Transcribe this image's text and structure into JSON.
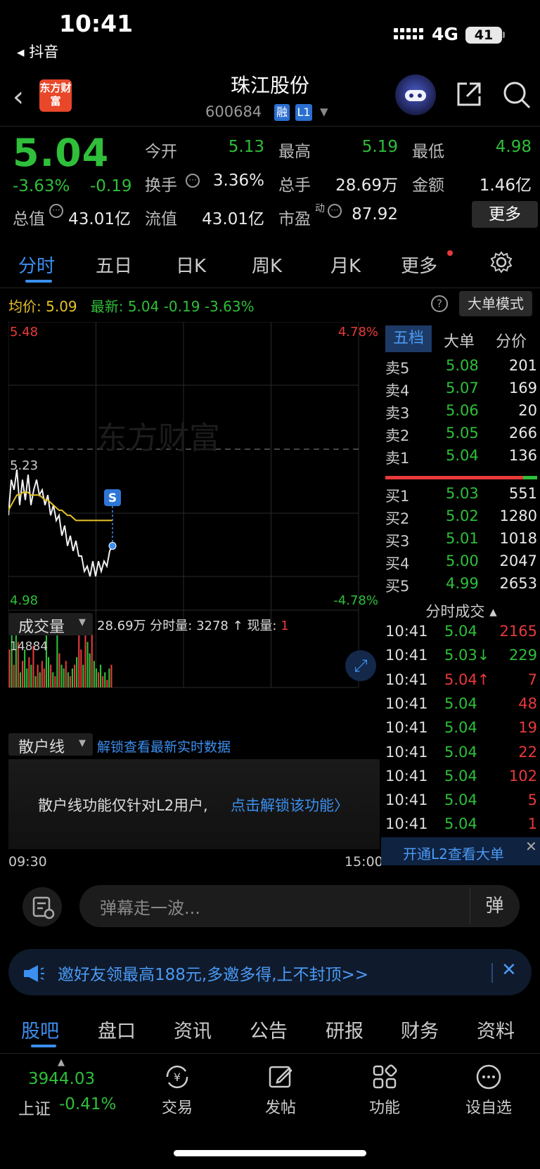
{
  "status_bar": {
    "time": "10:41",
    "back_app": "◂ 抖音",
    "network": "4G",
    "battery": "41"
  },
  "header": {
    "logo_text": "东方财富",
    "stock_name": "珠江股份",
    "stock_code": "600684",
    "tag_rong": "融",
    "tag_l1": "L1",
    "icons": [
      "back-icon",
      "robot-avatar-icon",
      "share-icon",
      "search-icon"
    ]
  },
  "quote": {
    "price": "5.04",
    "pct": "-3.63%",
    "change": "-0.19",
    "open_label": "今开",
    "open": "5.13",
    "high_label": "最高",
    "high": "5.19",
    "low_label": "最低",
    "low": "4.98",
    "turnover_rate_label": "换手",
    "turnover_rate": "3.36%",
    "volume_label": "总手",
    "volume": "28.69万",
    "amount_label": "金额",
    "amount": "1.46亿",
    "total_mv_label": "总值",
    "total_mv": "43.01亿",
    "float_mv_label": "流值",
    "float_mv": "43.01亿",
    "pe_label": "市盈",
    "pe_sup": "动",
    "pe": "87.92",
    "more_button": "更多"
  },
  "tabs": [
    "分时",
    "五日",
    "日K",
    "周K",
    "月K",
    "更多"
  ],
  "info_line": {
    "avg_label": "均价:",
    "avg": "5.09",
    "latest_label": "最新:",
    "latest": "5.04",
    "change": "-0.19",
    "pct": "-3.63%",
    "help": "?",
    "mode_button": "大单模式"
  },
  "chart_data": {
    "type": "line",
    "y_top": "5.48",
    "y_mid": "5.23",
    "y_bottom": "4.98",
    "pct_top": "4.78%",
    "pct_bottom": "-4.78%",
    "watermark": "东方财富",
    "marker": "S",
    "ylim": [
      4.98,
      5.48
    ],
    "prev_close": 5.23,
    "x_start": "09:30",
    "x_end": "15:00",
    "price_series": [
      5.1,
      5.17,
      5.15,
      5.19,
      5.12,
      5.17,
      5.13,
      5.18,
      5.12,
      5.15,
      5.17,
      5.14,
      5.15,
      5.12,
      5.14,
      5.1,
      5.12,
      5.09,
      5.1,
      5.06,
      5.08,
      5.04,
      5.06,
      5.03,
      5.05,
      5.02,
      5.02,
      4.99,
      5.0,
      4.98,
      5.01,
      4.98,
      5.01,
      4.99,
      5.01,
      5.0,
      5.03,
      5.04
    ],
    "avg_series": [
      5.11,
      5.12,
      5.13,
      5.14,
      5.14,
      5.145,
      5.145,
      5.145,
      5.14,
      5.14,
      5.14,
      5.14,
      5.135,
      5.13,
      5.13,
      5.125,
      5.12,
      5.115,
      5.11,
      5.11,
      5.105,
      5.1,
      5.1,
      5.095,
      5.09,
      5.09,
      5.09,
      5.09,
      5.09,
      5.09,
      5.09,
      5.09,
      5.09,
      5.09,
      5.09,
      5.09,
      5.09,
      5.09
    ]
  },
  "volume": {
    "dropdown": "成交量",
    "total": "28.69万",
    "fenshi_label": "分时量:",
    "fenshi_vol": "3278 ↑",
    "current_label": "现量:",
    "current": "1",
    "max": "14884",
    "bars": [
      0.5,
      0.8,
      0.3,
      0.95,
      0.6,
      0.2,
      0.35,
      0.5,
      0.25,
      0.4,
      0.3,
      0.55,
      0.15,
      0.3,
      0.2,
      0.35,
      0.25,
      0.7,
      0.4,
      0.3,
      0.2,
      0.15,
      0.8,
      0.45,
      0.3,
      0.25,
      0.35,
      0.2,
      0.15,
      0.25,
      0.3,
      0.4,
      0.75,
      0.5,
      0.3,
      0.8,
      0.6,
      0.45,
      0.7,
      0.35,
      0.25,
      0.2,
      0.3,
      0.15,
      0.2,
      0.1,
      0.25,
      0.3
    ],
    "bar_up": [
      true,
      false,
      true,
      false,
      true,
      false,
      true,
      false,
      false,
      true,
      false,
      true,
      false,
      true,
      false,
      true,
      true,
      false,
      false,
      true,
      false,
      true,
      false,
      true,
      false,
      false,
      true,
      false,
      true,
      false,
      true,
      false,
      true,
      true,
      false,
      true,
      false,
      false,
      true,
      false,
      false,
      true,
      false,
      true,
      false,
      true,
      false,
      true
    ]
  },
  "retail": {
    "dropdown": "散户线",
    "unlock": "解锁查看最新实时数据",
    "message": "散户线功能仅针对L2用户,",
    "link": "点击解锁该功能〉"
  },
  "order_book": {
    "tabs": [
      "五档",
      "大单",
      "分价"
    ],
    "asks": [
      {
        "label": "卖5",
        "price": "5.08",
        "qty": "201"
      },
      {
        "label": "卖4",
        "price": "5.07",
        "qty": "169"
      },
      {
        "label": "卖3",
        "price": "5.06",
        "qty": "20"
      },
      {
        "label": "卖2",
        "price": "5.05",
        "qty": "266"
      },
      {
        "label": "卖1",
        "price": "5.04",
        "qty": "136"
      }
    ],
    "bids": [
      {
        "label": "买1",
        "price": "5.03",
        "qty": "551"
      },
      {
        "label": "买2",
        "price": "5.02",
        "qty": "1280"
      },
      {
        "label": "买3",
        "price": "5.01",
        "qty": "1018"
      },
      {
        "label": "买4",
        "price": "5.00",
        "qty": "2047"
      },
      {
        "label": "买5",
        "price": "4.99",
        "qty": "2653"
      }
    ]
  },
  "trades": {
    "title": "分时成交 ▴",
    "rows": [
      {
        "time": "10:41",
        "price": "5.04",
        "vol": "2165",
        "color": "#e8393a"
      },
      {
        "time": "10:41",
        "price": "5.03↓",
        "vol": "229",
        "color": "#2fbf3a"
      },
      {
        "time": "10:41",
        "price": "5.04↑",
        "vol": "7",
        "color": "#e8393a"
      },
      {
        "time": "10:41",
        "price": "5.04",
        "vol": "48",
        "color": "#e8393a"
      },
      {
        "time": "10:41",
        "price": "5.04",
        "vol": "19",
        "color": "#e8393a"
      },
      {
        "time": "10:41",
        "price": "5.04",
        "vol": "22",
        "color": "#e8393a"
      },
      {
        "time": "10:41",
        "price": "5.04",
        "vol": "102",
        "color": "#e8393a"
      },
      {
        "time": "10:41",
        "price": "5.04",
        "vol": "5",
        "color": "#e8393a"
      },
      {
        "time": "10:41",
        "price": "5.04",
        "vol": "1",
        "color": "#e8393a"
      }
    ],
    "banner": "开通L2查看大单",
    "banner_close": "✕"
  },
  "comment": {
    "placeholder": "弹幕走一波...",
    "toggle": "弹"
  },
  "invite": {
    "text": "邀好友领最高188元,多邀多得,上不封顶>>",
    "close": "✕"
  },
  "subtabs": [
    "股吧",
    "盘口",
    "资讯",
    "公告",
    "研报",
    "财务",
    "资料"
  ],
  "bottom": {
    "index_value": "3944.03",
    "index_label": "上证",
    "index_pct": "-0.41%",
    "nav": [
      "交易",
      "发帖",
      "功能",
      "设自选"
    ]
  }
}
